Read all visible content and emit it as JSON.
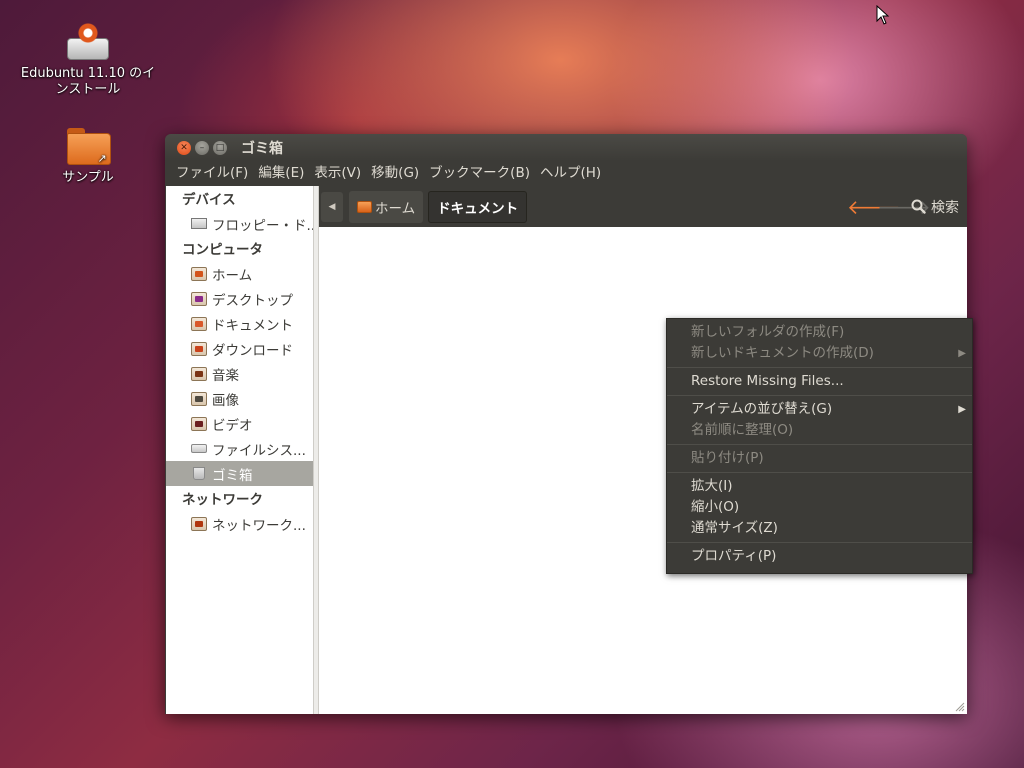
{
  "desktop": {
    "icons": [
      {
        "label": "Edubuntu 11.10 のインストール",
        "line1": "Edubuntu 11.10 のイ",
        "line2": "ンストール",
        "icon": "installer-icon"
      },
      {
        "label": "サンプル",
        "icon": "folder-link-icon"
      }
    ]
  },
  "window": {
    "title": "ゴミ箱",
    "menu": [
      "ファイル(F)",
      "編集(E)",
      "表示(V)",
      "移動(G)",
      "ブックマーク(B)",
      "ヘルプ(H)"
    ],
    "sidebar": {
      "sections": [
        {
          "heading": "デバイス",
          "items": [
            {
              "label": "フロッピー・ド...",
              "icon": "floppy-icon"
            }
          ]
        },
        {
          "heading": "コンピュータ",
          "items": [
            {
              "label": "ホーム",
              "icon": "home-folder-icon"
            },
            {
              "label": "デスクトップ",
              "icon": "desktop-folder-icon"
            },
            {
              "label": "ドキュメント",
              "icon": "documents-folder-icon"
            },
            {
              "label": "ダウンロード",
              "icon": "downloads-folder-icon"
            },
            {
              "label": "音楽",
              "icon": "music-folder-icon"
            },
            {
              "label": "画像",
              "icon": "pictures-folder-icon"
            },
            {
              "label": "ビデオ",
              "icon": "videos-folder-icon"
            },
            {
              "label": "ファイルシス...",
              "icon": "filesystem-icon"
            },
            {
              "label": "ゴミ箱",
              "icon": "trash-icon",
              "selected": true
            }
          ]
        },
        {
          "heading": "ネットワーク",
          "items": [
            {
              "label": "ネットワーク...",
              "icon": "network-folder-icon"
            }
          ]
        }
      ]
    },
    "pathbar": {
      "crumbs": [
        "ホーム",
        "ドキュメント"
      ],
      "search_label": "検索"
    }
  },
  "context_menu": {
    "items": [
      {
        "label": "新しいフォルダの作成(F)",
        "disabled": true
      },
      {
        "label": "新しいドキュメントの作成(D)",
        "disabled": true,
        "submenu": true
      },
      {
        "separator": true
      },
      {
        "label": "Restore Missing Files..."
      },
      {
        "separator": true
      },
      {
        "label": "アイテムの並び替え(G)",
        "submenu": true
      },
      {
        "label": "名前順に整理(O)",
        "disabled": true
      },
      {
        "separator": true
      },
      {
        "label": "貼り付け(P)",
        "disabled": true
      },
      {
        "separator": true
      },
      {
        "label": "拡大(I)"
      },
      {
        "label": "縮小(O)"
      },
      {
        "label": "通常サイズ(Z)"
      },
      {
        "separator": true
      },
      {
        "label": "プロパティ(P)"
      }
    ]
  },
  "colors": {
    "accent": "#f07b36",
    "window_bg": "#3c3b37",
    "menu_text": "#dfdbd2",
    "disabled_text": "#8d8a82",
    "selection": "#a7a6a0"
  }
}
